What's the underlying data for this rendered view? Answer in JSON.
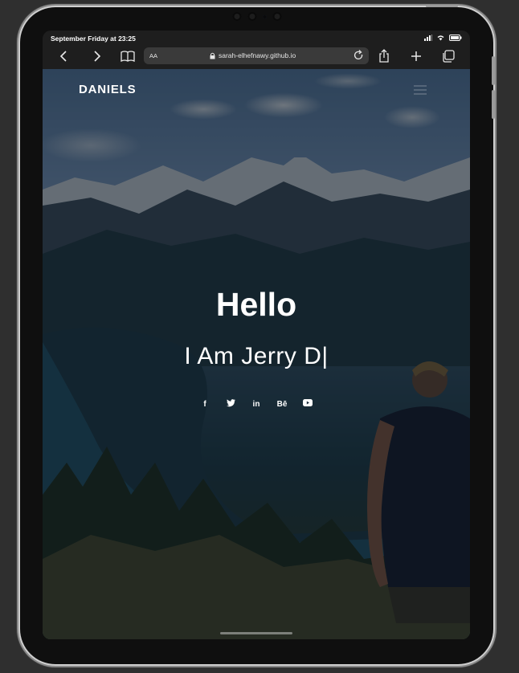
{
  "status_bar": {
    "time": "September Friday at 23:25"
  },
  "browser": {
    "text_size_label": "AA",
    "url": "sarah-elhefnawy.github.io"
  },
  "site": {
    "logo": "DANIELS",
    "greeting": "Hello",
    "tagline_prefix": "I Am",
    "tagline_name": "Jerry D|",
    "social": [
      {
        "icon": "facebook-icon",
        "glyph": "f"
      },
      {
        "icon": "twitter-icon",
        "glyph": "t"
      },
      {
        "icon": "linkedin-icon",
        "glyph": "in"
      },
      {
        "icon": "behance-icon",
        "glyph": "Bē"
      },
      {
        "icon": "youtube-icon",
        "glyph": "▶"
      }
    ]
  }
}
